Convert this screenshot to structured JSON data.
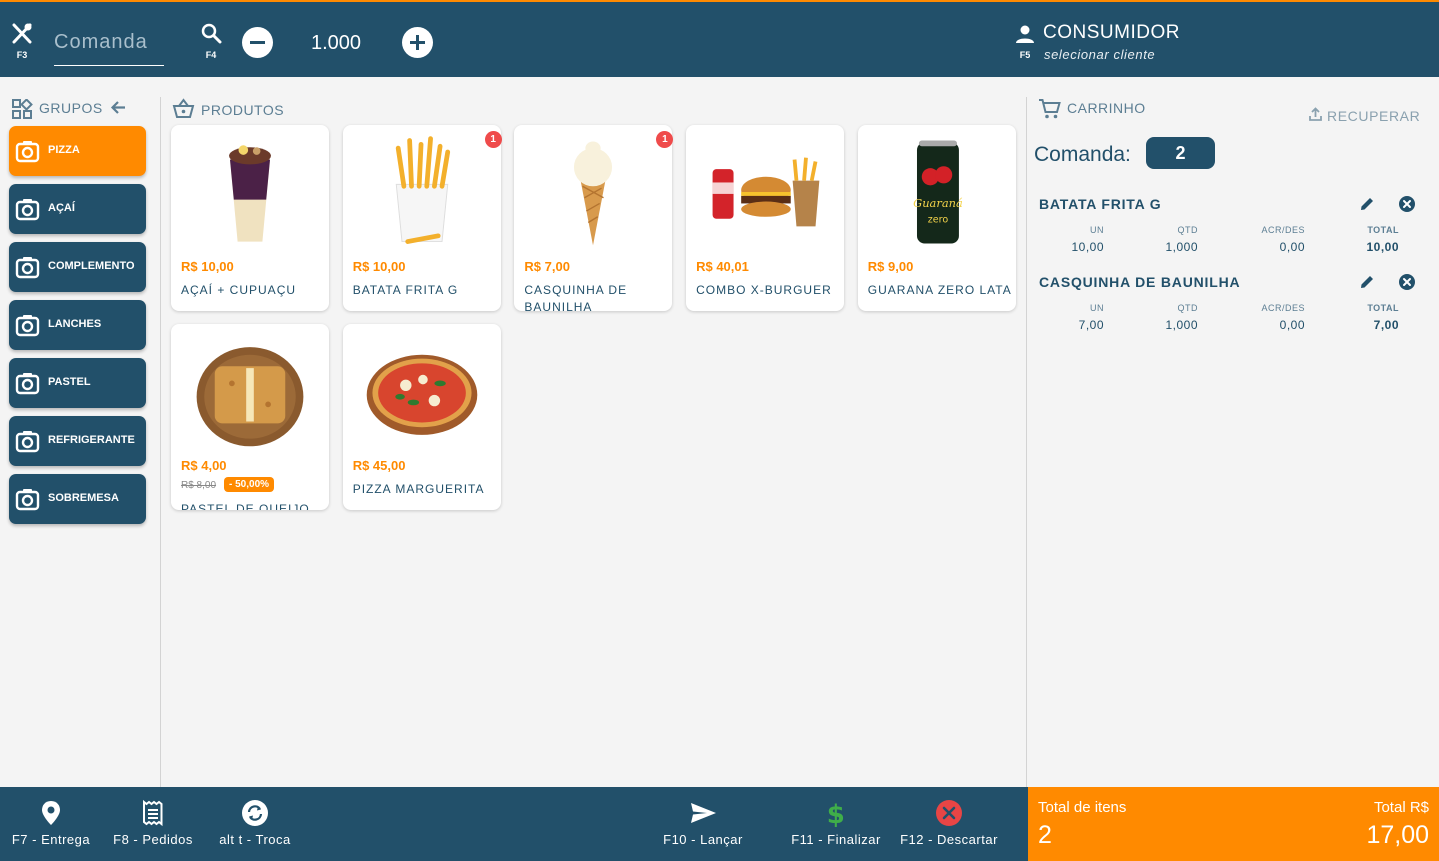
{
  "header": {
    "mesa_key": "F3",
    "comanda_placeholder": "Comanda",
    "search_key": "F4",
    "quantity": "1.000",
    "client_key": "F5",
    "client_name": "CONSUMIDOR",
    "client_action": "selecionar cliente"
  },
  "groups": {
    "title": "GRUPOS",
    "items": [
      {
        "label": "PIZZA",
        "active": true
      },
      {
        "label": "AÇAÍ"
      },
      {
        "label": "COMPLEMENTO"
      },
      {
        "label": "LANCHES"
      },
      {
        "label": "PASTEL"
      },
      {
        "label": "REFRIGERANTE"
      },
      {
        "label": "SOBREMESA"
      }
    ]
  },
  "products": {
    "title": "PRODUTOS",
    "items": [
      {
        "price": "R$ 10,00",
        "name": "AÇAÍ + CUPUAÇU",
        "icon": "acai-cup-image"
      },
      {
        "price": "R$ 10,00",
        "name": "BATATA FRITA G",
        "badge": "1",
        "icon": "fries-image"
      },
      {
        "price": "R$ 7,00",
        "name": "CASQUINHA DE BAUNILHA",
        "badge": "1",
        "icon": "ice-cream-cone-image"
      },
      {
        "price": "R$ 40,01",
        "name": "COMBO X-BURGUER",
        "icon": "burger-combo-image"
      },
      {
        "price": "R$ 9,00",
        "name": "GUARANA ZERO LATA",
        "icon": "soda-can-image"
      },
      {
        "price": "R$ 4,00",
        "old_price": "R$ 8,00",
        "discount": "- 50,00%",
        "name": "PASTEL DE QUEIJO",
        "icon": "pastel-image"
      },
      {
        "price": "R$ 45,00",
        "name": "PIZZA MARGUERITA",
        "icon": "pizza-image"
      }
    ]
  },
  "cart": {
    "title": "CARRINHO",
    "recover_label": "RECUPERAR",
    "comanda_label": "Comanda:",
    "comanda_number": "2",
    "headers": {
      "un": "UN",
      "qtd": "QTD",
      "acr": "ACR/DES",
      "total": "TOTAL"
    },
    "items": [
      {
        "name": "BATATA FRITA G",
        "un": "10,00",
        "qtd": "1,000",
        "acr": "0,00",
        "total": "10,00"
      },
      {
        "name": "CASQUINHA DE BAUNILHA",
        "un": "7,00",
        "qtd": "1,000",
        "acr": "0,00",
        "total": "7,00"
      }
    ]
  },
  "footer": {
    "entrega": "F7 - Entrega",
    "pedidos": "F8 - Pedidos",
    "troca": "alt t - Troca",
    "lancar": "F10 - Lançar",
    "finalizar": "F11 - Finalizar",
    "descartar": "F12 - Descartar"
  },
  "totals": {
    "items_label": "Total de itens",
    "items_value": "2",
    "total_label": "Total R$",
    "total_value": "17,00"
  },
  "colors": {
    "primary": "#22506a",
    "accent": "#ff8a00",
    "badge": "#ef4b4b",
    "finalize_icon": "#3fae49",
    "discard_icon": "#e84545"
  }
}
